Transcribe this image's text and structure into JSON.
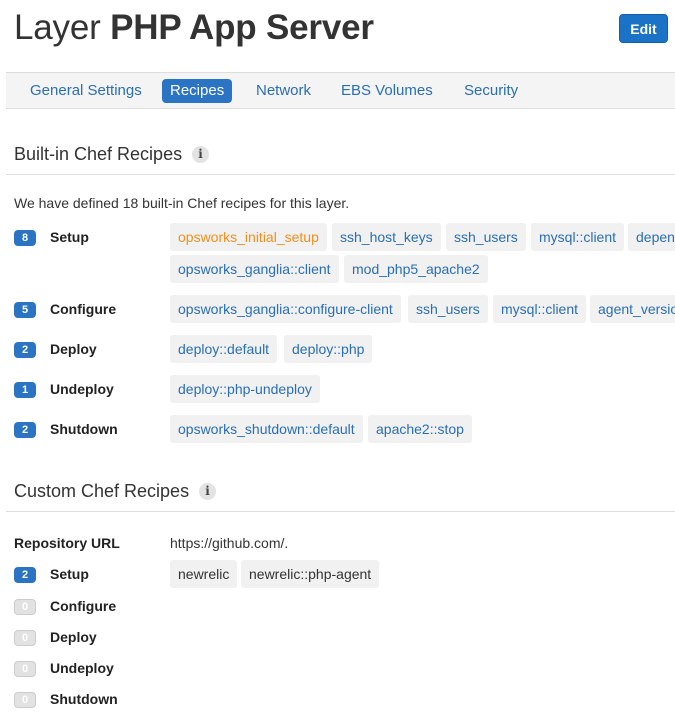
{
  "header": {
    "title_prefix": "Layer",
    "title_name": "PHP App Server",
    "edit_label": "Edit"
  },
  "tabs": [
    {
      "label": "General Settings",
      "active": false
    },
    {
      "label": "Recipes",
      "active": true
    },
    {
      "label": "Network",
      "active": false
    },
    {
      "label": "EBS Volumes",
      "active": false
    },
    {
      "label": "Security",
      "active": false
    }
  ],
  "builtin": {
    "heading": "Built-in Chef Recipes",
    "info_glyph": "i",
    "description": "We have defined 18 built-in Chef recipes for this layer.",
    "events": [
      {
        "count": "8",
        "label": "Setup",
        "recipes": [
          "opsworks_initial_setup",
          "ssh_host_keys",
          "ssh_users",
          "mysql::client",
          "depen",
          "opsworks_ganglia::client",
          "mod_php5_apache2"
        ]
      },
      {
        "count": "5",
        "label": "Configure",
        "recipes": [
          "opsworks_ganglia::configure-client",
          "ssh_users",
          "mysql::client",
          "agent_versio"
        ]
      },
      {
        "count": "2",
        "label": "Deploy",
        "recipes": [
          "deploy::default",
          "deploy::php"
        ]
      },
      {
        "count": "1",
        "label": "Undeploy",
        "recipes": [
          "deploy::php-undeploy"
        ]
      },
      {
        "count": "2",
        "label": "Shutdown",
        "recipes": [
          "opsworks_shutdown::default",
          "apache2::stop"
        ]
      }
    ]
  },
  "custom": {
    "heading": "Custom Chef Recipes",
    "info_glyph": "i",
    "repo_label": "Repository URL",
    "repo_url": "https://github.com/.",
    "events": [
      {
        "count": "2",
        "label": "Setup",
        "recipes": [
          "newrelic",
          "newrelic::php-agent"
        ]
      },
      {
        "count": "0",
        "label": "Configure",
        "recipes": []
      },
      {
        "count": "0",
        "label": "Deploy",
        "recipes": []
      },
      {
        "count": "0",
        "label": "Undeploy",
        "recipes": []
      },
      {
        "count": "0",
        "label": "Shutdown",
        "recipes": []
      }
    ]
  },
  "colors": {
    "accent": "#2b74c3",
    "link": "#2a6eb5",
    "highlight": "#f0901c",
    "chip_bg": "#f1f1f1"
  }
}
